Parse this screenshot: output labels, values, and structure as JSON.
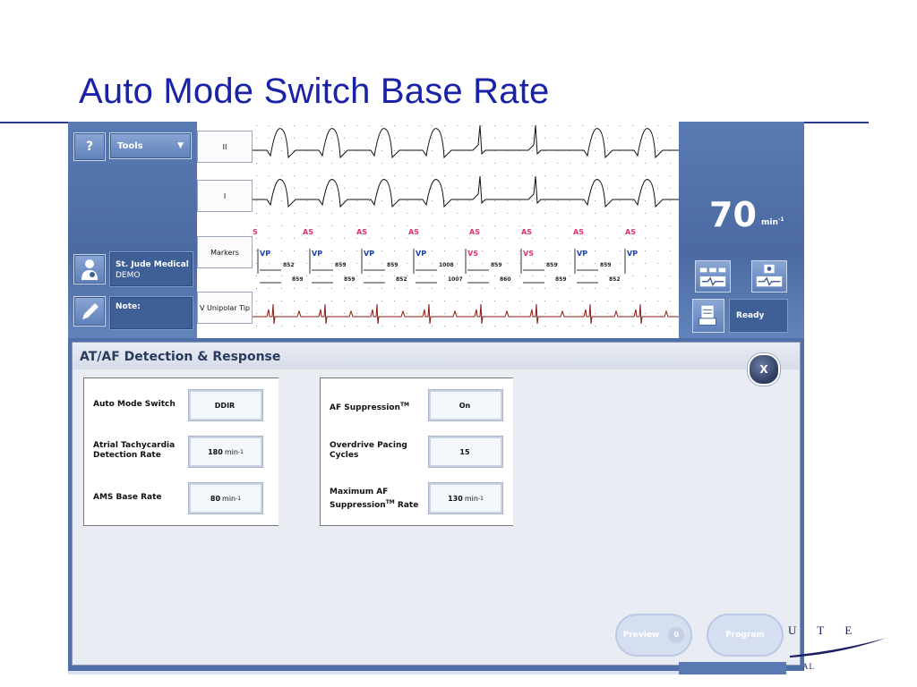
{
  "slide": {
    "title": "Auto Mode Switch Base Rate"
  },
  "toolbar": {
    "help_label": "?",
    "tools_label": "Tools"
  },
  "patient": {
    "name": "St. Jude Medical",
    "id": "DEMO"
  },
  "note": {
    "label": "Note:"
  },
  "ecg": {
    "leads": [
      "II",
      "I",
      "Markers",
      "V Unipolar Tip"
    ],
    "atrial_markers": [
      "S",
      "AS",
      "AS",
      "AS",
      "AS",
      "AS",
      "AS",
      "AS"
    ],
    "ventricular_markers": [
      "VP",
      "VP",
      "VP",
      "VP",
      "VS",
      "VS",
      "VP",
      "VP"
    ],
    "vv_intervals": [
      "852",
      "859",
      "859",
      "1008",
      "859",
      "859",
      "859"
    ],
    "av_intervals": [
      "859",
      "859",
      "852",
      "1007",
      "860",
      "859",
      "852"
    ]
  },
  "rate": {
    "value": "70",
    "unit": "min",
    "unit_exp": "-1"
  },
  "status": {
    "text": "Ready"
  },
  "panel": {
    "title": "AT/AF Detection & Response",
    "close_label": "X",
    "left_group": [
      {
        "label": "Auto Mode Switch",
        "value": "DDIR",
        "unit": "",
        "exp": ""
      },
      {
        "label": "Atrial Tachycardia\nDetection Rate",
        "value": "180",
        "unit": "min",
        "exp": "-1"
      },
      {
        "label": "AMS Base Rate",
        "value": "80",
        "unit": "min",
        "exp": "-1"
      }
    ],
    "right_group": [
      {
        "label": "AF Suppression",
        "label_sup": "TM",
        "value": "On",
        "unit": "",
        "exp": ""
      },
      {
        "label": "Overdrive Pacing\nCycles",
        "value": "15",
        "unit": "",
        "exp": ""
      },
      {
        "label": "Maximum AF\nSuppression",
        "label_sup": "TM",
        "label_tail": " Rate",
        "value": "130",
        "unit": "min",
        "exp": "-1"
      }
    ]
  },
  "actions": {
    "preview_label": "Preview",
    "preview_count": "0",
    "program_label": "Program"
  },
  "logo": {
    "text_top": "U T E",
    "text_bottom": "AL"
  },
  "colors": {
    "title": "#1a22a8",
    "chrome": "#4e6fa8",
    "marker_pink": "#e0336b",
    "marker_blue": "#1a3fae",
    "ecg_red": "#8b1a0e"
  }
}
